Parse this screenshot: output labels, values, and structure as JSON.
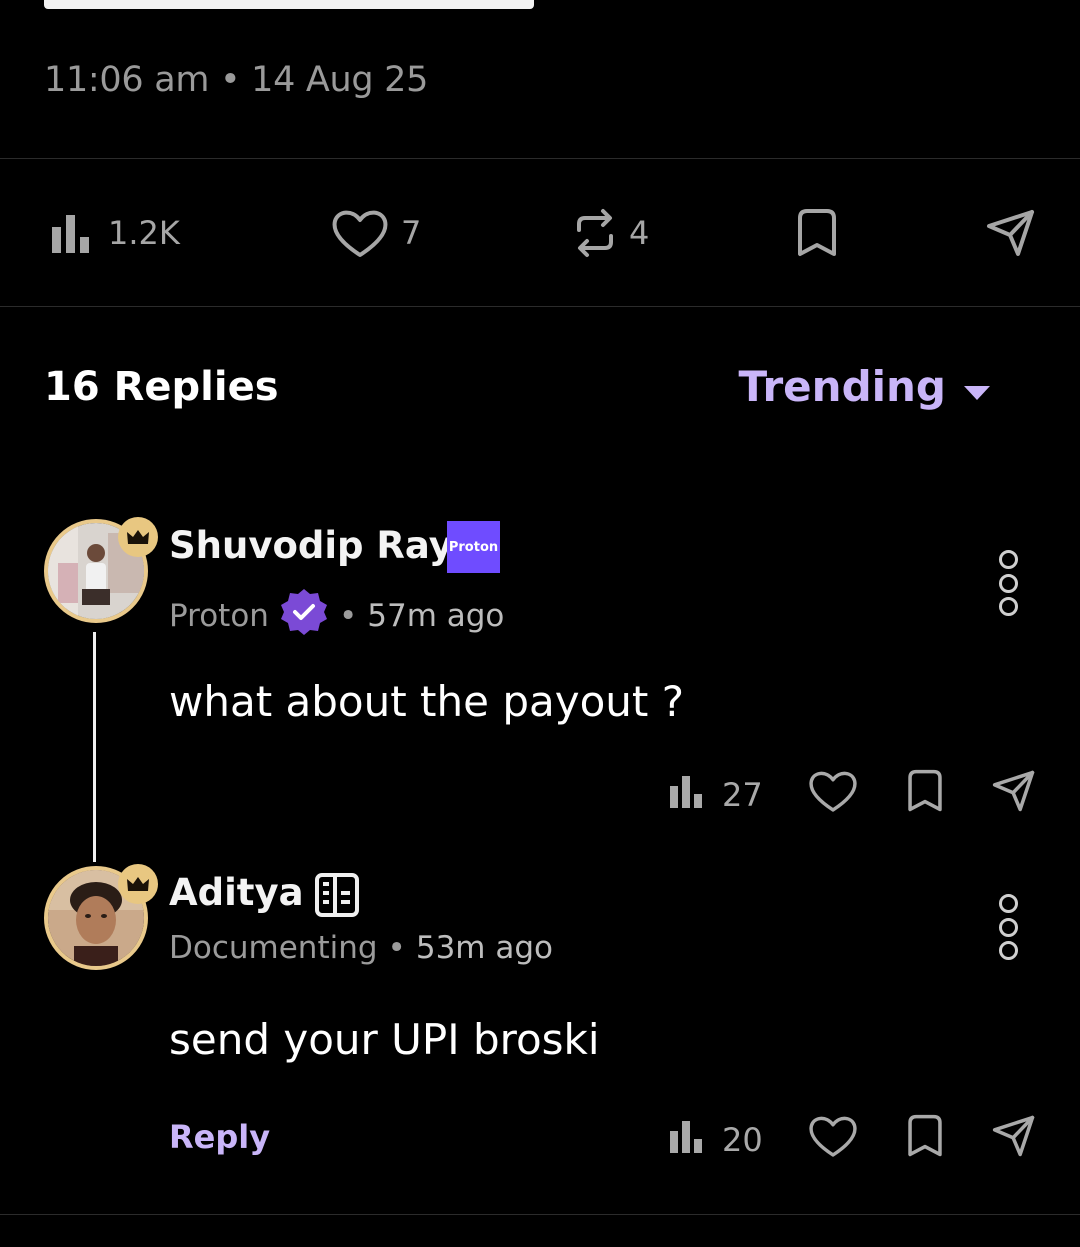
{
  "post": {
    "timestamp": "11:06 am • 14 Aug 25",
    "stats": {
      "views": "1.2K",
      "likes": "7",
      "reposts": "4"
    }
  },
  "replies_header": {
    "title": "16 Replies",
    "sort_label": "Trending"
  },
  "comments": [
    {
      "username": "Shuvodip Ray",
      "company_badge": "Proton",
      "org": "Proton",
      "separator": "•",
      "time": "57m ago",
      "text": "what about the payout ?",
      "views": "27"
    },
    {
      "username": "Aditya",
      "org": "Documenting",
      "separator": "•",
      "time": "53m ago",
      "text": "send your UPI broski",
      "reply_label": "Reply",
      "views": "20"
    }
  ],
  "colors": {
    "accent": "#c9b5f8",
    "avatar_ring": "#e9c98b",
    "verified": "#7b4ad6",
    "proton": "#6f4cff"
  }
}
